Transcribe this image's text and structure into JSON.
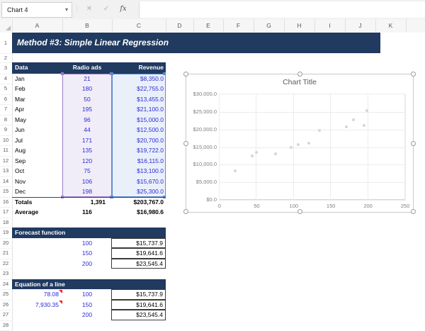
{
  "formula_bar": {
    "name_box_value": "Chart 4",
    "chevron": "▾",
    "dots": "⋮",
    "cancel_icon": "✕",
    "confirm_icon": "✓",
    "fx_icon": "fx",
    "formula_value": ""
  },
  "grid": {
    "column_letters": [
      "A",
      "B",
      "C",
      "D",
      "E",
      "F",
      "G",
      "H",
      "I",
      "J",
      "K"
    ],
    "visible_rows": 28
  },
  "banner_title": "Method #3: Simple Linear Regression",
  "data_table": {
    "header": {
      "data": "Data",
      "ads": "Radio ads",
      "revenue": "Revenue"
    },
    "months": [
      "Jan",
      "Feb",
      "Mar",
      "Apr",
      "May",
      "Jun",
      "Jul",
      "Aug",
      "Sep",
      "Oct",
      "Nov",
      "Dec"
    ],
    "ads": [
      "21",
      "180",
      "50",
      "195",
      "96",
      "44",
      "171",
      "135",
      "120",
      "75",
      "106",
      "198"
    ],
    "revenue": [
      "$8,350.0",
      "$22,755.0",
      "$13,455.0",
      "$21,100.0",
      "$15,000.0",
      "$12,500.0",
      "$20,700.0",
      "$19,722.0",
      "$16,115.0",
      "$13,100.0",
      "$15,670.0",
      "$25,300.0"
    ],
    "totals": {
      "label": "Totals",
      "ads": "1,391",
      "revenue": "$203,767.0"
    },
    "average": {
      "label": "Average",
      "ads": "116",
      "revenue": "$16,980.6"
    }
  },
  "forecast": {
    "header": "Forecast function",
    "inputs": [
      "100",
      "150",
      "200"
    ],
    "outputs": [
      "$15,737.9",
      "$19,641.6",
      "$23,545.4"
    ]
  },
  "equation": {
    "header": "Equation of a line",
    "slope": "78.08",
    "intercept": "7,930.35",
    "inputs": [
      "100",
      "150",
      "200"
    ],
    "outputs": [
      "$15,737.9",
      "$19,641.6",
      "$23,545.4"
    ]
  },
  "chart_data": {
    "type": "scatter",
    "title": "Chart Title",
    "x": [
      21,
      180,
      50,
      195,
      96,
      44,
      171,
      135,
      120,
      75,
      106,
      198
    ],
    "y": [
      8350,
      22755,
      13455,
      21100,
      15000,
      12500,
      20700,
      19722,
      16115,
      13100,
      15670,
      25300
    ],
    "xlim": [
      0,
      250
    ],
    "ylim": [
      0,
      30000
    ],
    "x_ticks": [
      0,
      50,
      100,
      150,
      200,
      250
    ],
    "x_tick_labels": [
      "0",
      "50",
      "100",
      "150",
      "200",
      "250"
    ],
    "y_ticks": [
      0,
      5000,
      10000,
      15000,
      20000,
      25000,
      30000
    ],
    "y_tick_labels": [
      "$0.0",
      "$5,000.0",
      "$10,000.0",
      "$15,000.0",
      "$20,000.0",
      "$25,000.0",
      "$30,000.0"
    ],
    "grid": true,
    "legend": false,
    "point_color": "#d6d6d6"
  },
  "colors": {
    "navy": "#203a60",
    "input_blue": "#2b2bd5",
    "selection_purple": "#9a7bc8",
    "selection_blue": "#5b8bd0",
    "lavender_fill": "#f1edf8",
    "blue_fill": "#eaf0fa",
    "comment_red": "#ff1a1a"
  }
}
